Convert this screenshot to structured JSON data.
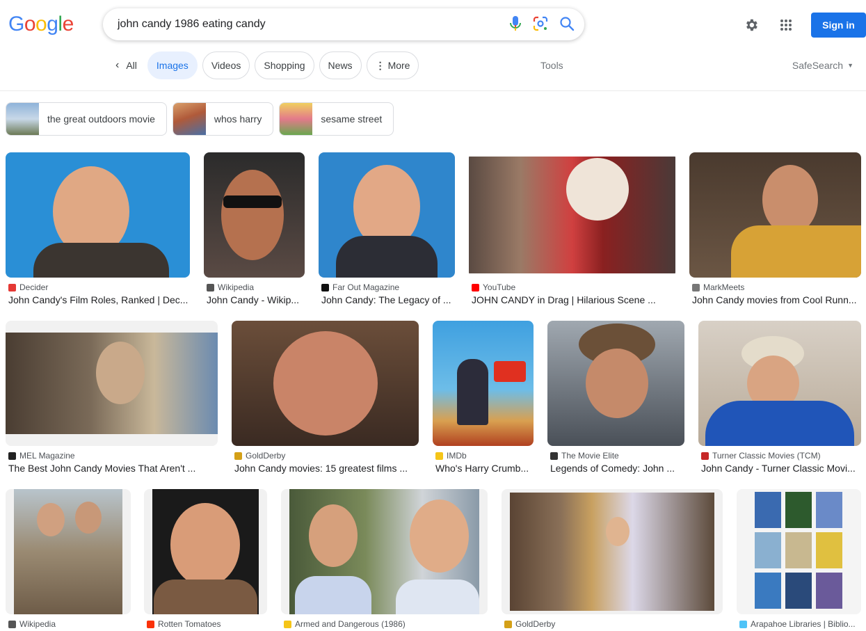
{
  "header": {
    "logo_letters": [
      "G",
      "o",
      "o",
      "g",
      "l",
      "e"
    ],
    "logo_colors": [
      "#4285f4",
      "#ea4335",
      "#fbbc05",
      "#4285f4",
      "#34a853",
      "#ea4335"
    ],
    "query": "john candy 1986 eating candy",
    "icons": [
      "mic-icon",
      "lens-icon",
      "search-icon",
      "gear-icon",
      "apps-grid-icon"
    ],
    "signin_label": "Sign in"
  },
  "tabs": {
    "all_label": "All",
    "items": [
      "Images",
      "Videos",
      "Shopping",
      "News",
      "More"
    ],
    "active": "Images",
    "tools_label": "Tools",
    "safesearch_label": "SafeSearch"
  },
  "chips": [
    {
      "label": "the great outdoors movie"
    },
    {
      "label": "whos harry"
    },
    {
      "label": "sesame street"
    }
  ],
  "results": [
    {
      "source": "Decider",
      "title": "John Candy's Film Roles, Ranked | Dec...",
      "favicon_color": "#e53935"
    },
    {
      "source": "Wikipedia",
      "title": "John Candy - Wikip...",
      "favicon_color": "#555555"
    },
    {
      "source": "Far Out Magazine",
      "title": "John Candy: The Legacy of ...",
      "favicon_color": "#111111"
    },
    {
      "source": "YouTube",
      "title": "JOHN CANDY in Drag | Hilarious Scene ...",
      "favicon_color": "#ff0000"
    },
    {
      "source": "MarkMeets",
      "title": "John Candy movies from Cool Runn...",
      "favicon_color": "#777777"
    },
    {
      "source": "MEL Magazine",
      "title": "The Best John Candy Movies That Aren't ...",
      "favicon_color": "#222222"
    },
    {
      "source": "GoldDerby",
      "title": "John Candy movies: 15 greatest films ...",
      "favicon_color": "#d4a017"
    },
    {
      "source": "IMDb",
      "title": "Who's Harry Crumb...",
      "favicon_color": "#f5c518"
    },
    {
      "source": "The Movie Elite",
      "title": "Legends of Comedy: John ...",
      "favicon_color": "#333333"
    },
    {
      "source": "Turner Classic Movies (TCM)",
      "title": "John Candy - Turner Classic Movi...",
      "favicon_color": "#c62828"
    },
    {
      "source": "Wikipedia",
      "title": "",
      "favicon_color": "#555555"
    },
    {
      "source": "Rotten Tomatoes",
      "title": "",
      "favicon_color": "#fa320a"
    },
    {
      "source": "Armed and Dangerous (1986)",
      "title": "",
      "favicon_color": "#f5c518"
    },
    {
      "source": "GoldDerby",
      "title": "",
      "favicon_color": "#d4a017"
    },
    {
      "source": "Arapahoe Libraries | Biblio...",
      "title": "",
      "favicon_color": "#4fc3f7"
    }
  ]
}
